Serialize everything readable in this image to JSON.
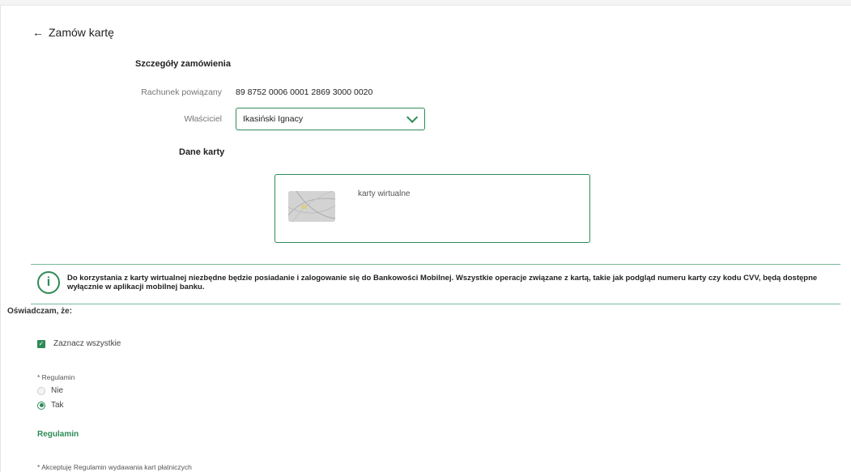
{
  "header": {
    "back_icon": "arrow-left-icon",
    "title": "Zamów kartę"
  },
  "order": {
    "section_title": "Szczegóły zamówienia",
    "account_label": "Rachunek powiązany",
    "account_value": "89 8752 0006 0001 2869 3000 0020",
    "owner_label": "Właściciel",
    "owner_value": "Ikasiński Ignacy"
  },
  "card": {
    "section_title": "Dane karty",
    "name": "karty wirtualne"
  },
  "info": {
    "icon": "info-icon",
    "text": "Do korzystania z karty wirtualnej niezbędne będzie posiadanie i zalogowanie się do Bankowości Mobilnej. Wszystkie operacje związane z kartą, takie jak podgląd numeru karty czy kodu CVV, będą dostępne wyłącznie w aplikacji mobilnej banku."
  },
  "declarations": {
    "title": "Oświadczam, że:",
    "select_all_label": "Zaznacz wszystkie",
    "regulamin_label": "* Regulamin",
    "option_no": "Nie",
    "option_yes": "Tak",
    "regulamin_link": "Regulamin",
    "accept_label": "* Akceptuję Regulamin wydawania kart płatniczych"
  },
  "colors": {
    "accent": "#2e8b57"
  }
}
